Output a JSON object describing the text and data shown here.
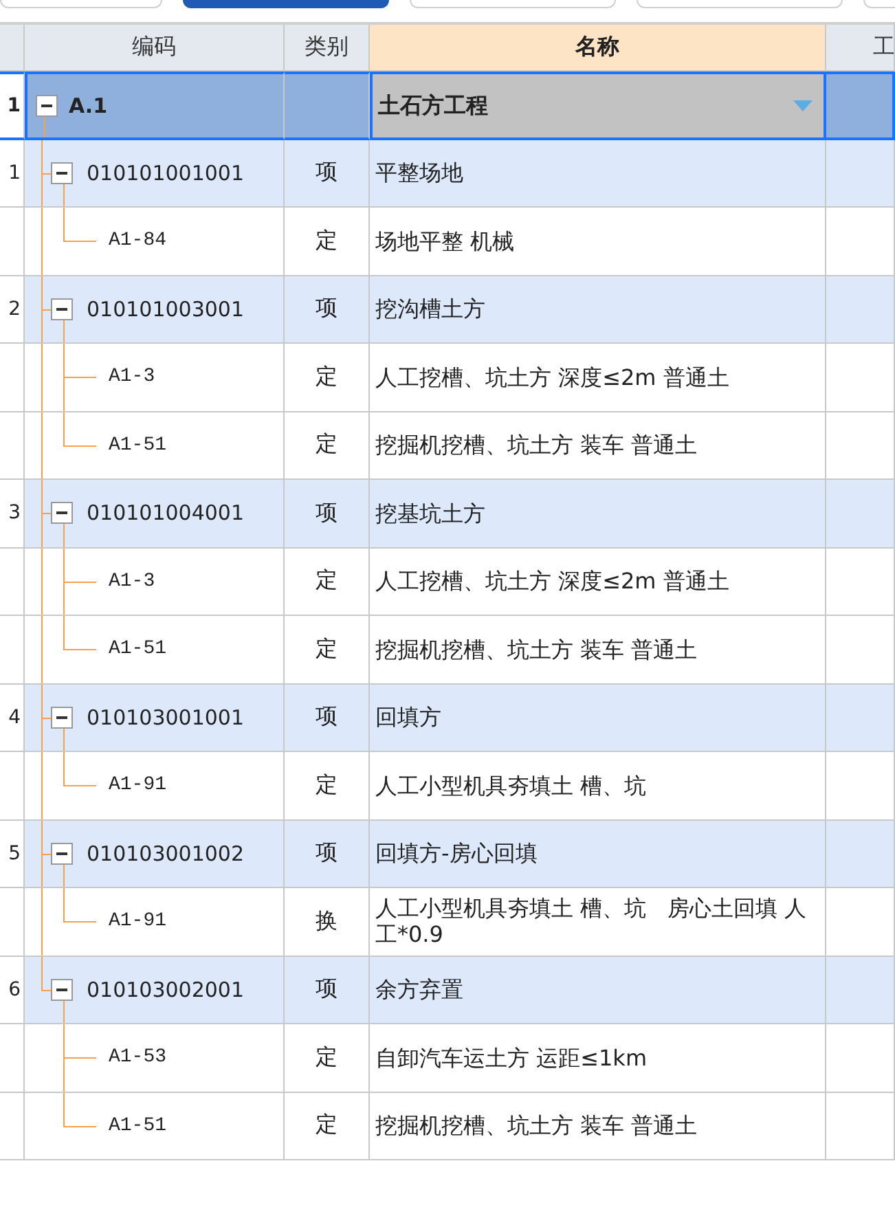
{
  "top_buttons": [
    {
      "selected": false
    },
    {
      "selected": true
    },
    {
      "selected": false
    },
    {
      "selected": false
    },
    {
      "selected": false
    }
  ],
  "columns": [
    {
      "label": "编码",
      "selected": false
    },
    {
      "label": "类别",
      "selected": false
    },
    {
      "label": "名称",
      "selected": true
    },
    {
      "label": "工",
      "selected": false
    }
  ],
  "rows": [
    {
      "index": "1",
      "code": "A.1",
      "name": "土石方工程",
      "selected": true,
      "expanded": true,
      "children": [
        {
          "index": "1",
          "code": "010101001001",
          "type": "项",
          "name": "平整场地",
          "selected": false,
          "expanded": true,
          "children": [
            {
              "code": "A1-84",
              "type": "定",
              "name": "场地平整 机械",
              "selected": false
            }
          ]
        },
        {
          "index": "2",
          "code": "010101003001",
          "type": "项",
          "name": "挖沟槽土方",
          "selected": false,
          "expanded": true,
          "children": [
            {
              "code": "A1-3",
              "type": "定",
              "name": "人工挖槽、坑土方 深度≤2m 普通土",
              "selected": false
            },
            {
              "code": "A1-51",
              "type": "定",
              "name": "挖掘机挖槽、坑土方 装车 普通土",
              "selected": false
            }
          ]
        },
        {
          "index": "3",
          "code": "010101004001",
          "type": "项",
          "name": "挖基坑土方",
          "selected": false,
          "expanded": true,
          "children": [
            {
              "code": "A1-3",
              "type": "定",
              "name": "人工挖槽、坑土方 深度≤2m 普通土",
              "selected": false
            },
            {
              "code": "A1-51",
              "type": "定",
              "name": "挖掘机挖槽、坑土方 装车 普通土",
              "selected": false
            }
          ]
        },
        {
          "index": "4",
          "code": "010103001001",
          "type": "项",
          "name": "回填方",
          "selected": false,
          "expanded": true,
          "children": [
            {
              "code": "A1-91",
              "type": "定",
              "name": "人工小型机具夯填土 槽、坑",
              "selected": false
            }
          ]
        },
        {
          "index": "5",
          "code": "010103001002",
          "type": "项",
          "name": "回填方-房心回填",
          "selected": false,
          "expanded": true,
          "children": [
            {
              "code": "A1-91",
              "type": "换",
              "name": "人工小型机具夯填土 槽、坑   房心土回填 人工*0.9",
              "selected": false
            }
          ]
        },
        {
          "index": "6",
          "code": "010103002001",
          "type": "项",
          "name": "余方弃置",
          "selected": false,
          "expanded": true,
          "children": [
            {
              "code": "A1-53",
              "type": "定",
              "name": "自卸汽车运土方 运距≤1km",
              "selected": false
            },
            {
              "code": "A1-51",
              "type": "定",
              "name": "挖掘机挖槽、坑土方 装车 普通土",
              "selected": false
            }
          ]
        }
      ]
    }
  ]
}
